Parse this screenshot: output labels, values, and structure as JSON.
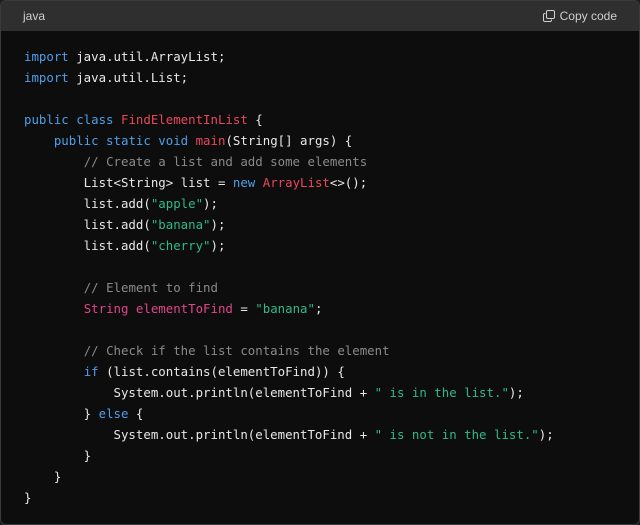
{
  "header": {
    "language": "java",
    "copy_label": "Copy code"
  },
  "colors": {
    "keyword": "#4f9ee8",
    "type": "#e0458a",
    "class_name": "#e8485a",
    "string": "#2fb98c",
    "comment": "#8a8a8a",
    "text": "#e8e8e8",
    "background": "#0d0d0d",
    "header_background": "#2f2f2f"
  },
  "code": {
    "lines": [
      [
        {
          "t": "kw",
          "v": "import"
        },
        {
          "t": "",
          "v": " java.util.ArrayList;"
        }
      ],
      [
        {
          "t": "kw",
          "v": "import"
        },
        {
          "t": "",
          "v": " java.util.List;"
        }
      ],
      [],
      [
        {
          "t": "kw",
          "v": "public class"
        },
        {
          "t": "",
          "v": " "
        },
        {
          "t": "cls",
          "v": "FindElementInList"
        },
        {
          "t": "",
          "v": " {"
        }
      ],
      [
        {
          "t": "",
          "v": "    "
        },
        {
          "t": "kw",
          "v": "public static void"
        },
        {
          "t": "",
          "v": " "
        },
        {
          "t": "cls",
          "v": "main"
        },
        {
          "t": "",
          "v": "(String[] args) {"
        }
      ],
      [
        {
          "t": "",
          "v": "        "
        },
        {
          "t": "cmt",
          "v": "// Create a list and add some elements"
        }
      ],
      [
        {
          "t": "",
          "v": "        List<String> list = "
        },
        {
          "t": "kw",
          "v": "new"
        },
        {
          "t": "",
          "v": " "
        },
        {
          "t": "cls",
          "v": "ArrayList"
        },
        {
          "t": "",
          "v": "<>();"
        }
      ],
      [
        {
          "t": "",
          "v": "        list.add("
        },
        {
          "t": "str",
          "v": "\"apple\""
        },
        {
          "t": "",
          "v": ");"
        }
      ],
      [
        {
          "t": "",
          "v": "        list.add("
        },
        {
          "t": "str",
          "v": "\"banana\""
        },
        {
          "t": "",
          "v": ");"
        }
      ],
      [
        {
          "t": "",
          "v": "        list.add("
        },
        {
          "t": "str",
          "v": "\"cherry\""
        },
        {
          "t": "",
          "v": ");"
        }
      ],
      [],
      [
        {
          "t": "",
          "v": "        "
        },
        {
          "t": "cmt",
          "v": "// Element to find"
        }
      ],
      [
        {
          "t": "",
          "v": "        "
        },
        {
          "t": "typ",
          "v": "String elementToFind"
        },
        {
          "t": "",
          "v": " = "
        },
        {
          "t": "str",
          "v": "\"banana\""
        },
        {
          "t": "",
          "v": ";"
        }
      ],
      [],
      [
        {
          "t": "",
          "v": "        "
        },
        {
          "t": "cmt",
          "v": "// Check if the list contains the element"
        }
      ],
      [
        {
          "t": "",
          "v": "        "
        },
        {
          "t": "kw",
          "v": "if"
        },
        {
          "t": "",
          "v": " (list.contains(elementToFind)) {"
        }
      ],
      [
        {
          "t": "",
          "v": "            System.out.println(elementToFind + "
        },
        {
          "t": "str",
          "v": "\" is in the list.\""
        },
        {
          "t": "",
          "v": ");"
        }
      ],
      [
        {
          "t": "",
          "v": "        } "
        },
        {
          "t": "kw",
          "v": "else"
        },
        {
          "t": "",
          "v": " {"
        }
      ],
      [
        {
          "t": "",
          "v": "            System.out.println(elementToFind + "
        },
        {
          "t": "str",
          "v": "\" is not in the list.\""
        },
        {
          "t": "",
          "v": ");"
        }
      ],
      [
        {
          "t": "",
          "v": "        }"
        }
      ],
      [
        {
          "t": "",
          "v": "    }"
        }
      ],
      [
        {
          "t": "",
          "v": "}"
        }
      ]
    ]
  }
}
